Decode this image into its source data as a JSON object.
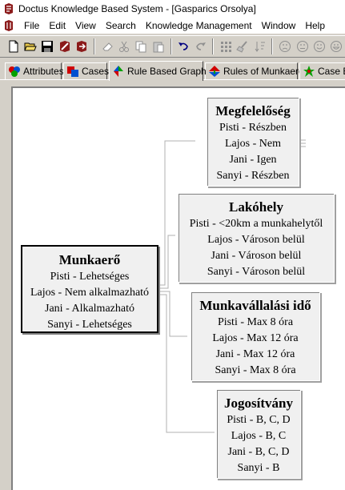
{
  "window": {
    "title": "Doctus Knowledge Based System - [Gasparics Orsolya]"
  },
  "menu": [
    "File",
    "Edit",
    "View",
    "Search",
    "Knowledge Management",
    "Window",
    "Help"
  ],
  "toolbar": {
    "buttons": [
      "new-icon",
      "open-icon",
      "save-icon",
      "cut-rule-icon",
      "paste-rule-icon",
      "eraser-icon",
      "scissors-icon",
      "copy-icon",
      "paste-icon",
      "undo-icon",
      "redo-icon",
      "grid-icon",
      "broom-icon",
      "sort-icon",
      "sad-face-icon",
      "neutral-face-icon",
      "happy-face-icon",
      "smile-face-icon"
    ]
  },
  "tabs": [
    {
      "label": "Attributes",
      "icon": "attributes-icon",
      "active": false
    },
    {
      "label": "Cases",
      "icon": "cases-icon",
      "active": false
    },
    {
      "label": "Rule Based Graph",
      "icon": "rule-graph-icon",
      "active": true
    },
    {
      "label": "Rules of Munkaerő",
      "icon": "rules-icon",
      "active": false
    },
    {
      "label": "Case B",
      "icon": "case-based-icon",
      "active": false
    }
  ],
  "graph": {
    "root": {
      "title": "Munkaerő",
      "rows": [
        "Pisti - Lehetséges",
        "Lajos - Nem alkalmazható",
        "Jani - Alkalmazható",
        "Sanyi - Lehetséges"
      ]
    },
    "children": [
      {
        "title": "Megfelelőség",
        "rows": [
          "Pisti - Részben",
          "Lajos - Nem",
          "Jani - Igen",
          "Sanyi - Részben"
        ]
      },
      {
        "title": "Lakóhely",
        "rows": [
          "Pisti - <20km a munkahelytől",
          "Lajos - Városon belül",
          "Jani - Városon belül",
          "Sanyi - Városon belül"
        ]
      },
      {
        "title": "Munkavállalási idő",
        "rows": [
          "Pisti - Max 8 óra",
          "Lajos - Max 12 óra",
          "Jani - Max 12 óra",
          "Sanyi - Max 8 óra"
        ]
      },
      {
        "title": "Jogosítvány",
        "rows": [
          "Pisti - B, C, D",
          "Lajos - B, C",
          "Jani - B, C, D",
          "Sanyi - B"
        ]
      }
    ]
  }
}
